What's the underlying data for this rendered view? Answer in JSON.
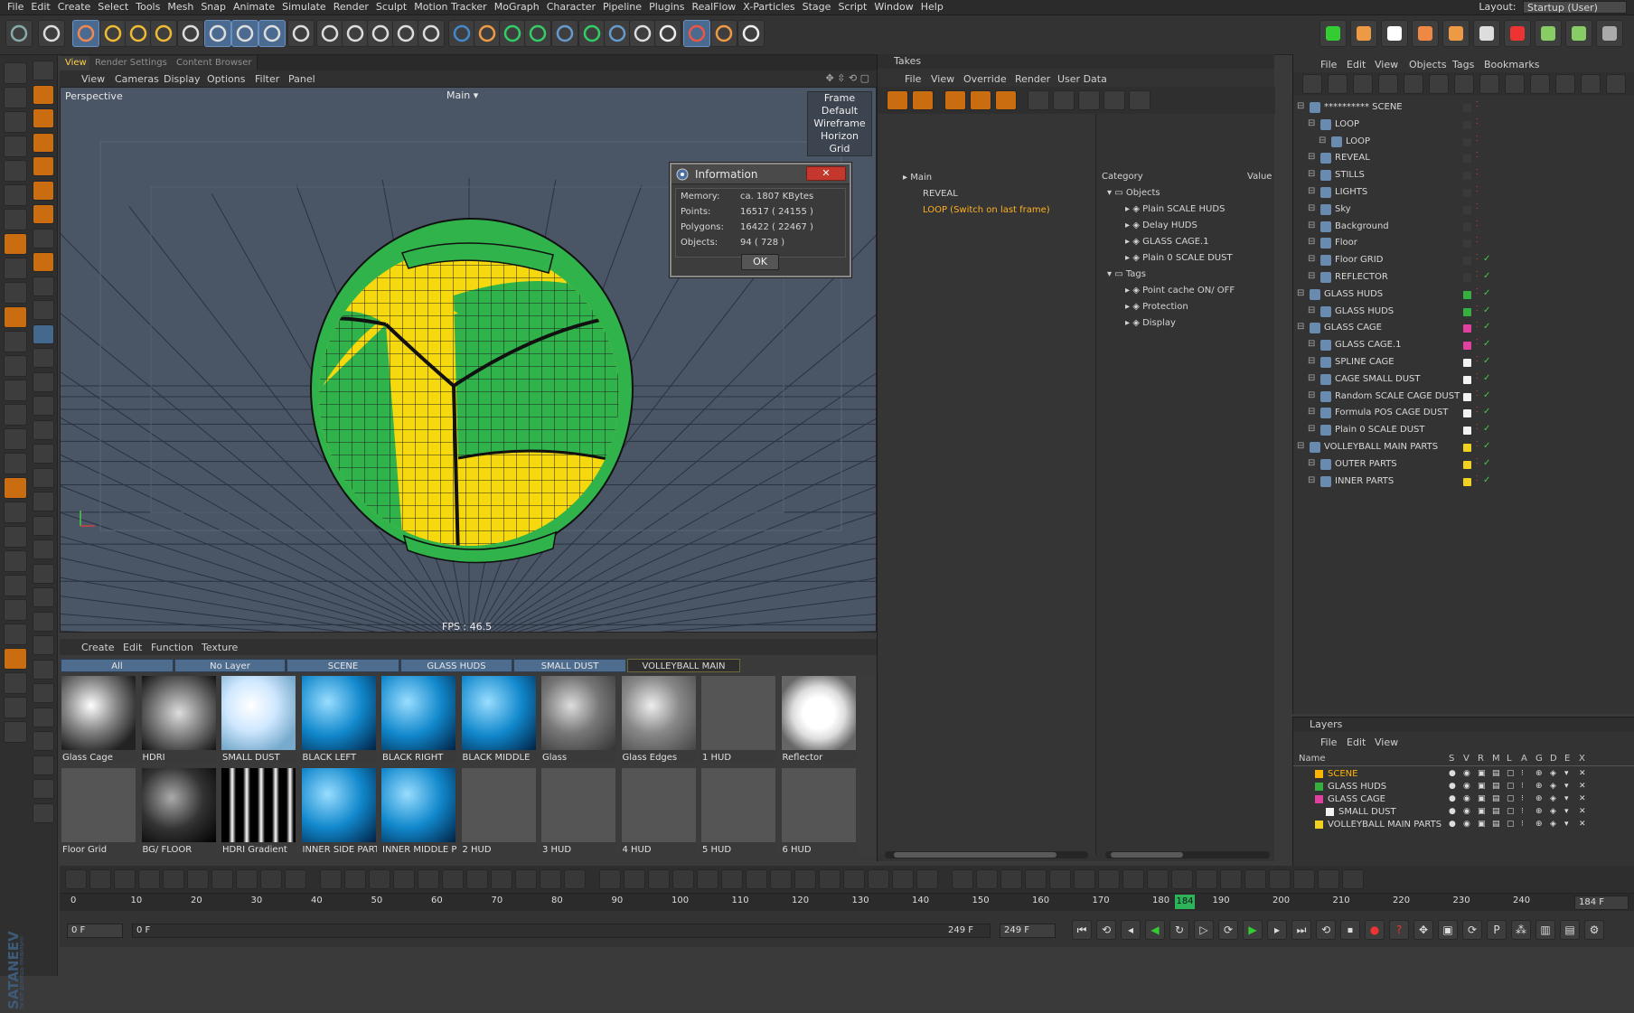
{
  "menubar": {
    "items": [
      "File",
      "Edit",
      "Create",
      "Select",
      "Tools",
      "Mesh",
      "Snap",
      "Animate",
      "Simulate",
      "Render",
      "Sculpt",
      "Motion Tracker",
      "MoGraph",
      "Character",
      "Pipeline",
      "Plugins",
      "RealFlow",
      "X-Particles",
      "Stage",
      "Script",
      "Window",
      "Help"
    ],
    "layout_label": "Layout:",
    "layout_value": "Startup (User)"
  },
  "viewport": {
    "tabs": [
      "View",
      "Render Settings",
      "Content Browser"
    ],
    "menu": [
      "View",
      "Cameras",
      "Display",
      "Options",
      "Filter",
      "Panel"
    ],
    "camera_label": "Perspective",
    "camera_name": "Main",
    "options": [
      "Frame Default",
      "Wireframe",
      "Horizon",
      "Grid"
    ],
    "fps": "FPS : 46.5"
  },
  "info_dialog": {
    "title": "Information",
    "rows": [
      {
        "label": "Memory:",
        "value": "ca. 1807 KBytes"
      },
      {
        "label": "Points:",
        "value": "16517 ( 24155 )"
      },
      {
        "label": "Polygons:",
        "value": "16422 ( 22467 )"
      },
      {
        "label": "Objects:",
        "value": "94 ( 728 )"
      }
    ],
    "ok": "OK"
  },
  "material_manager": {
    "menu": [
      "Create",
      "Edit",
      "Function",
      "Texture"
    ],
    "layer_tabs": [
      "All",
      "No Layer",
      "SCENE",
      "GLASS HUDS",
      "SMALL DUST",
      "VOLLEYBALL MAIN PARTS"
    ],
    "materials_row1": [
      "Glass Cage",
      "HDRI",
      "SMALL DUST",
      "BLACK LEFT",
      "BLACK RIGHT",
      "BLACK MIDDLE",
      "Glass",
      "Glass Edges",
      "1 HUD",
      "Reflector"
    ],
    "materials_row2": [
      "Floor Grid",
      "BG/ FLOOR",
      "HDRI Gradient",
      "INNER SIDE PARTS",
      "INNER MIDDLE P",
      "2 HUD",
      "3 HUD",
      "4 HUD",
      "5 HUD",
      "6 HUD"
    ]
  },
  "timeline": {
    "ticks": [
      "0",
      "10",
      "20",
      "30",
      "40",
      "50",
      "60",
      "70",
      "80",
      "90",
      "100",
      "110",
      "120",
      "130",
      "140",
      "150",
      "160",
      "170",
      "180",
      "190",
      "200",
      "210",
      "220",
      "230",
      "240"
    ],
    "current_marker": "184",
    "current_frame": "184 F",
    "start_field": "0 F",
    "range_start": "0 F",
    "range_end": "249 F",
    "end_field": "249 F"
  },
  "takes": {
    "title": "Takes",
    "menu": [
      "File",
      "View",
      "Override",
      "Render",
      "User Data"
    ],
    "items": [
      "Main",
      "REVEAL",
      "LOOP (Switch on last frame)"
    ],
    "category_header": "Category",
    "value_header": "Value",
    "categories": [
      {
        "label": "Objects",
        "children": [
          "Plain SCALE HUDS",
          "Delay HUDS",
          "GLASS CAGE.1",
          "Plain 0 SCALE DUST"
        ]
      },
      {
        "label": "Tags",
        "children": [
          "Point cache ON/ OFF",
          "Protection",
          "Display"
        ]
      }
    ]
  },
  "object_manager": {
    "menu": [
      "File",
      "Edit",
      "View",
      "Objects",
      "Tags",
      "Bookmarks"
    ],
    "rows": [
      {
        "name": "********** SCENE",
        "indent": 0,
        "color": "#3a3a3a"
      },
      {
        "name": "LOOP",
        "indent": 1,
        "color": "#3a3a3a"
      },
      {
        "name": "LOOP",
        "indent": 2,
        "color": "#3a3a3a"
      },
      {
        "name": "REVEAL",
        "indent": 1,
        "color": "#3a3a3a"
      },
      {
        "name": "STILLS",
        "indent": 1,
        "color": "#3a3a3a"
      },
      {
        "name": "LIGHTS",
        "indent": 1,
        "color": "#3a3a3a"
      },
      {
        "name": "Sky",
        "indent": 1,
        "color": "#3a3a3a"
      },
      {
        "name": "Background",
        "indent": 1,
        "color": "#3a3a3a"
      },
      {
        "name": "Floor",
        "indent": 1,
        "color": "#3a3a3a"
      },
      {
        "name": "Floor GRID",
        "indent": 1,
        "color": "#3a3a3a"
      },
      {
        "name": "REFLECTOR",
        "indent": 1,
        "color": "#3a3a3a"
      },
      {
        "name": "GLASS HUDS",
        "indent": 0,
        "color": "#35b040"
      },
      {
        "name": "GLASS HUDS",
        "indent": 1,
        "color": "#35b040"
      },
      {
        "name": "GLASS CAGE",
        "indent": 0,
        "color": "#e040a0"
      },
      {
        "name": "GLASS CAGE.1",
        "indent": 1,
        "color": "#e040a0"
      },
      {
        "name": "SPLINE CAGE",
        "indent": 1,
        "color": "#f2f2f2"
      },
      {
        "name": "CAGE SMALL DUST",
        "indent": 1,
        "color": "#f2f2f2"
      },
      {
        "name": "Random SCALE CAGE DUST",
        "indent": 1,
        "color": "#f2f2f2"
      },
      {
        "name": "Formula POS CAGE DUST",
        "indent": 1,
        "color": "#f2f2f2"
      },
      {
        "name": "Plain 0 SCALE DUST",
        "indent": 1,
        "color": "#f2f2f2"
      },
      {
        "name": "VOLLEYBALL MAIN PARTS",
        "indent": 0,
        "color": "#f0d020"
      },
      {
        "name": "OUTER PARTS",
        "indent": 1,
        "color": "#f0d020"
      },
      {
        "name": "INNER PARTS",
        "indent": 1,
        "color": "#f0d020"
      }
    ]
  },
  "layers": {
    "title": "Layers",
    "menu": [
      "File",
      "Edit",
      "View"
    ],
    "columns": [
      "Name",
      "S",
      "V",
      "R",
      "M",
      "L",
      "A",
      "G",
      "D",
      "E",
      "X"
    ],
    "rows": [
      {
        "name": "SCENE",
        "color": "#ffb400",
        "text_color": "#ffb400",
        "indent": 0
      },
      {
        "name": "GLASS HUDS",
        "color": "#35b040",
        "text_color": "#d8d8d8",
        "indent": 0
      },
      {
        "name": "GLASS CAGE",
        "color": "#e040a0",
        "text_color": "#d8d8d8",
        "indent": 0
      },
      {
        "name": "SMALL DUST",
        "color": "#f2f2f2",
        "text_color": "#d8d8d8",
        "indent": 1
      },
      {
        "name": "VOLLEYBALL MAIN PARTS",
        "color": "#f0d020",
        "text_color": "#d8d8d8",
        "indent": 0
      }
    ]
  },
  "watermark": "SATANEEV",
  "watermark_sub": "ТЫ ВСЕ ДЕЛАЕШЬ ПРАВИЛЬНО"
}
